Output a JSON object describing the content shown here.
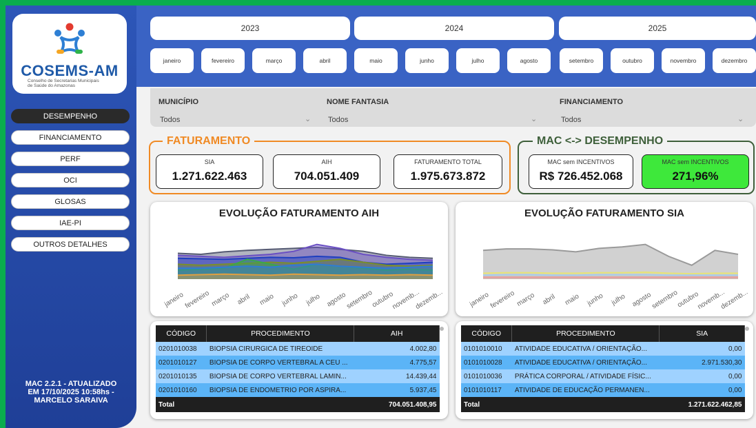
{
  "logo": {
    "title": "COSEMS-AM",
    "subtitle_1": "Conselho de Secretarias Municipais",
    "subtitle_2": "de Saúde do Amazonas",
    "colors": {
      "blue": "#2e7fd4",
      "red": "#e33b2f",
      "orange": "#f5a623",
      "green": "#2fb34a"
    }
  },
  "sidebar": {
    "items": [
      {
        "label": "DESEMPENHO",
        "active": true
      },
      {
        "label": "FINANCIAMENTO"
      },
      {
        "label": "PERF"
      },
      {
        "label": "OCI"
      },
      {
        "label": "GLOSAS"
      },
      {
        "label": "IAE-PI"
      },
      {
        "label": "OUTROS DETALHES"
      }
    ],
    "version_1": "MAC 2.2.1 - ATUALIZADO",
    "version_2": "EM 17/10/2025 10:58hs -",
    "version_3": "MARCELO SARAIVA"
  },
  "years": [
    "2023",
    "2024",
    "2025"
  ],
  "months": [
    "janeiro",
    "fevereiro",
    "março",
    "abril",
    "maio",
    "junho",
    "julho",
    "agosto",
    "setembro",
    "outubro",
    "novembro",
    "dezembro"
  ],
  "filters": {
    "municipio": {
      "label": "MUNICÍPIO",
      "value": "Todos"
    },
    "nome_fantasia": {
      "label": "NOME FANTASIA",
      "value": "Todos"
    },
    "financiamento": {
      "label": "FINANCIAMENTO",
      "value": "Todos"
    }
  },
  "faturamento": {
    "title": "FATURAMENTO",
    "sia_label": "SIA",
    "sia_value": "1.271.622.463",
    "aih_label": "AIH",
    "aih_value": "704.051.409",
    "total_label": "FATURAMENTO TOTAL",
    "total_value": "1.975.673.872",
    "accent": "#f08a24"
  },
  "mac": {
    "title": "MAC <-> DESEMPENHO",
    "sem_inc_label": "MAC sem INCENTIVOS",
    "sem_inc_value": "R$ 726.452.068",
    "sem_inc_pct_label": "MAC sem INCENTIVOS",
    "sem_inc_pct_value": "271,96%",
    "accent": "#3e5f3a",
    "highlight": "#3ee83b"
  },
  "chart_data": [
    {
      "type": "area",
      "title": "EVOLUÇÃO FATURAMENTO AIH",
      "categories": [
        "janeiro",
        "fevereiro",
        "março",
        "abril",
        "maio",
        "junho",
        "julho",
        "agosto",
        "setembro",
        "outubro",
        "novemb...",
        "dezemb..."
      ],
      "ylim": [
        0,
        100
      ],
      "grid": false,
      "series": [
        {
          "color": "#555a73",
          "values": [
            52,
            50,
            55,
            58,
            60,
            62,
            64,
            60,
            56,
            48,
            44,
            42
          ]
        },
        {
          "color": "#6a4fc3",
          "values": [
            48,
            46,
            44,
            47,
            50,
            56,
            70,
            62,
            50,
            44,
            40,
            38
          ]
        },
        {
          "color": "#1f3fbf",
          "values": [
            42,
            41,
            40,
            42,
            44,
            43,
            46,
            44,
            34,
            30,
            32,
            34
          ]
        },
        {
          "color": "#7a8f2a",
          "values": [
            30,
            28,
            30,
            32,
            34,
            32,
            36,
            40,
            34,
            28,
            26,
            28
          ]
        },
        {
          "color": "#3aa84a",
          "values": [
            18,
            20,
            22,
            40,
            30,
            20,
            30,
            26,
            22,
            18,
            20,
            18
          ]
        },
        {
          "color": "#2f7bd6",
          "values": [
            22,
            22,
            24,
            26,
            24,
            28,
            30,
            26,
            24,
            22,
            24,
            26
          ]
        },
        {
          "color": "#e0a040",
          "values": [
            8,
            9,
            10,
            9,
            8,
            10,
            9,
            8,
            9,
            8,
            9,
            8
          ]
        }
      ]
    },
    {
      "type": "area",
      "title": "EVOLUÇÃO FATURAMENTO SIA",
      "categories": [
        "janeiro",
        "fevereiro",
        "março",
        "abril",
        "maio",
        "junho",
        "julho",
        "agosto",
        "setembro",
        "outubro",
        "novemb...",
        "dezemb..."
      ],
      "ylim": [
        0,
        100
      ],
      "grid": false,
      "series": [
        {
          "color": "#9a9a9a",
          "values": [
            58,
            61,
            61,
            59,
            55,
            62,
            65,
            70,
            46,
            28,
            58,
            50
          ]
        },
        {
          "color": "#e6e27a",
          "values": [
            12,
            13,
            13,
            12,
            12,
            13,
            13,
            14,
            12,
            11,
            12,
            12
          ]
        },
        {
          "color": "#a8c8f0",
          "values": [
            8,
            9,
            9,
            8,
            8,
            9,
            9,
            9,
            8,
            8,
            8,
            8
          ]
        },
        {
          "color": "#e89a9a",
          "values": [
            4,
            4,
            4,
            4,
            4,
            4,
            4,
            4,
            4,
            4,
            4,
            4
          ]
        }
      ]
    }
  ],
  "table_aih": {
    "headers": [
      "CÓDIGO",
      "PROCEDIMENTO",
      "AIH"
    ],
    "rows": [
      [
        "0201010038",
        "BIOPSIA CIRURGICA DE TIREOIDE",
        "4.002,80"
      ],
      [
        "0201010127",
        "BIOPSIA DE CORPO VERTEBRAL A CEU ...",
        "4.775,57"
      ],
      [
        "0201010135",
        "BIOPSIA DE CORPO VERTEBRAL LAMIN...",
        "14.439,44"
      ],
      [
        "0201010160",
        "BIOPSIA DE ENDOMETRIO POR ASPIRA...",
        "5.937,45"
      ]
    ],
    "total_label": "Total",
    "total_value": "704.051.408,95"
  },
  "table_sia": {
    "headers": [
      "CÓDIGO",
      "PROCEDIMENTO",
      "SIA"
    ],
    "rows": [
      [
        "0101010010",
        "ATIVIDADE EDUCATIVA / ORIENTAÇÃO...",
        "0,00"
      ],
      [
        "0101010028",
        "ATIVIDADE EDUCATIVA / ORIENTAÇÃO...",
        "2.971.530,30"
      ],
      [
        "0101010036",
        "PRÁTICA CORPORAL / ATIVIDADE FÍSIC...",
        "0,00"
      ],
      [
        "0101010117",
        "ATIVIDADE DE EDUCAÇÃO PERMANEN...",
        "0,00"
      ]
    ],
    "total_label": "Total",
    "total_value": "1.271.622.462,85"
  }
}
